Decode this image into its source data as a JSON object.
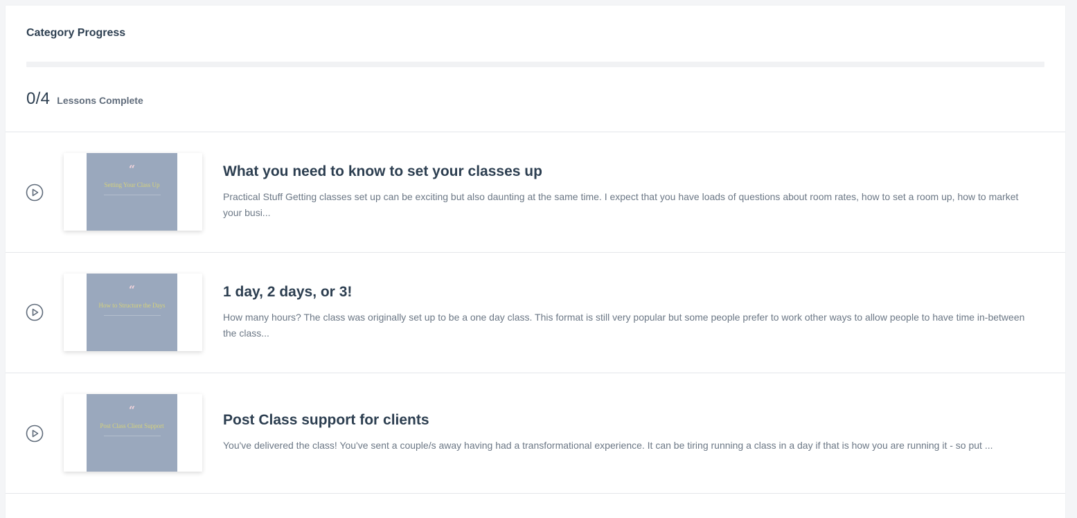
{
  "category": {
    "title": "Category Progress",
    "progress_fraction": 0,
    "count": "0/4",
    "count_label": "Lessons Complete"
  },
  "lessons": [
    {
      "title": "What you need to know to set your classes up",
      "description": "Practical Stuff Getting classes set up can be exciting but also daunting at the same time. I expect that you have loads of questions about room rates, how to set a room up, how to market your busi...",
      "thumb_quote": "“",
      "thumb_title": "Setting Your Class Up",
      "icon": "play-circle-icon"
    },
    {
      "title": "1 day, 2 days, or 3!",
      "description": "How many hours? The class was originally set up to be a one day class. This format is still very popular but some people prefer to work other ways to allow people to have time in-between the class...",
      "thumb_quote": "“",
      "thumb_title": "How to Structure the Days",
      "icon": "play-circle-icon"
    },
    {
      "title": "Post Class support for clients",
      "description": "You've delivered the class!  You've sent a couple/s away having had a transformational experience.  It can be tiring running a class in a day if that is how you are running it - so put ...",
      "thumb_quote": "“",
      "thumb_title": "Post Class Client Support",
      "icon": "play-circle-icon"
    }
  ],
  "colors": {
    "text_primary": "#2c3e50",
    "text_secondary": "#6b7785",
    "thumb_background": "#9aa8bd",
    "thumb_title": "#d7d37a",
    "thumb_quote": "#f3d4dc",
    "icon": "#5f6b7a"
  }
}
